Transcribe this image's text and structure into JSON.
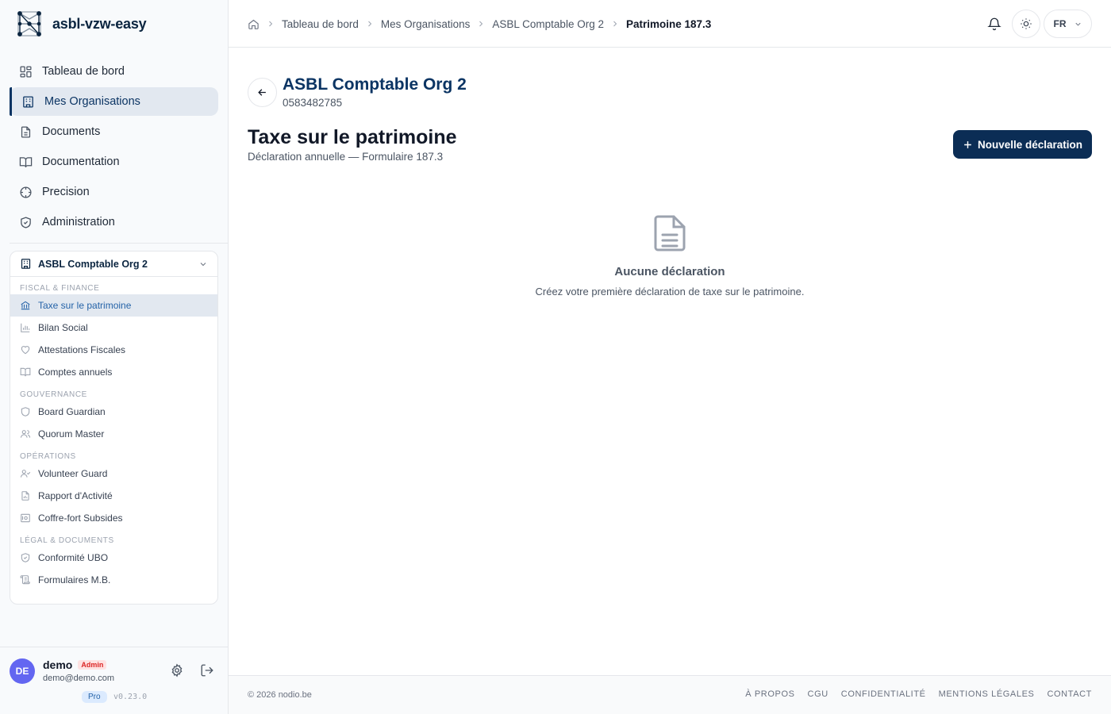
{
  "brand": {
    "name": "asbl-vzw-easy"
  },
  "main_nav": [
    {
      "label": "Tableau de bord",
      "icon": "dashboard-icon"
    },
    {
      "label": "Mes Organisations",
      "icon": "building-icon",
      "active": true
    },
    {
      "label": "Documents",
      "icon": "document-icon"
    },
    {
      "label": "Documentation",
      "icon": "book-icon"
    },
    {
      "label": "Precision",
      "icon": "crosshair-icon"
    },
    {
      "label": "Administration",
      "icon": "shield-icon"
    }
  ],
  "org_panel": {
    "title": "ASBL Comptable Org 2",
    "sections": [
      {
        "label": "Fiscal & Finance",
        "items": [
          {
            "label": "Taxe sur le patrimoine",
            "icon": "bank-icon",
            "active": true
          },
          {
            "label": "Bilan Social",
            "icon": "bar-chart-icon"
          },
          {
            "label": "Attestations Fiscales",
            "icon": "heart-icon"
          },
          {
            "label": "Comptes annuels",
            "icon": "book-icon"
          }
        ]
      },
      {
        "label": "Gouvernance",
        "items": [
          {
            "label": "Board Guardian",
            "icon": "shield-icon"
          },
          {
            "label": "Quorum Master",
            "icon": "users-icon"
          }
        ]
      },
      {
        "label": "Opérations",
        "items": [
          {
            "label": "Volunteer Guard",
            "icon": "user-check-icon"
          },
          {
            "label": "Rapport d'Activité",
            "icon": "file-chart-icon"
          },
          {
            "label": "Coffre-fort Subsides",
            "icon": "vault-icon"
          }
        ]
      },
      {
        "label": "Légal & Documents",
        "items": [
          {
            "label": "Conformité UBO",
            "icon": "shield-check-icon"
          },
          {
            "label": "Formulaires M.B.",
            "icon": "scroll-icon"
          }
        ]
      }
    ]
  },
  "user": {
    "initials": "DE",
    "name": "demo",
    "role": "Admin",
    "email": "demo@demo.com",
    "plan": "Pro",
    "version": "v0.23.0"
  },
  "breadcrumb": {
    "items": [
      "Tableau de bord",
      "Mes Organisations",
      "ASBL Comptable Org 2"
    ],
    "current": "Patrimoine 187.3"
  },
  "header": {
    "language": "FR"
  },
  "page": {
    "org_name": "ASBL Comptable Org 2",
    "org_number": "0583482785",
    "title": "Taxe sur le patrimoine",
    "subtitle": "Déclaration annuelle — Formulaire 187.3",
    "new_button": "Nouvelle déclaration",
    "empty_title": "Aucune déclaration",
    "empty_text": "Créez votre première déclaration de taxe sur le patrimoine."
  },
  "footer": {
    "copyright": "© 2026 nodio.be",
    "links": [
      "À propos",
      "CGU",
      "Confidentialité",
      "Mentions légales",
      "Contact"
    ]
  },
  "colors": {
    "brand": "#0b2540",
    "accent": "#0b2d55",
    "active_link": "#2563a8",
    "avatar": "#6366f1"
  }
}
